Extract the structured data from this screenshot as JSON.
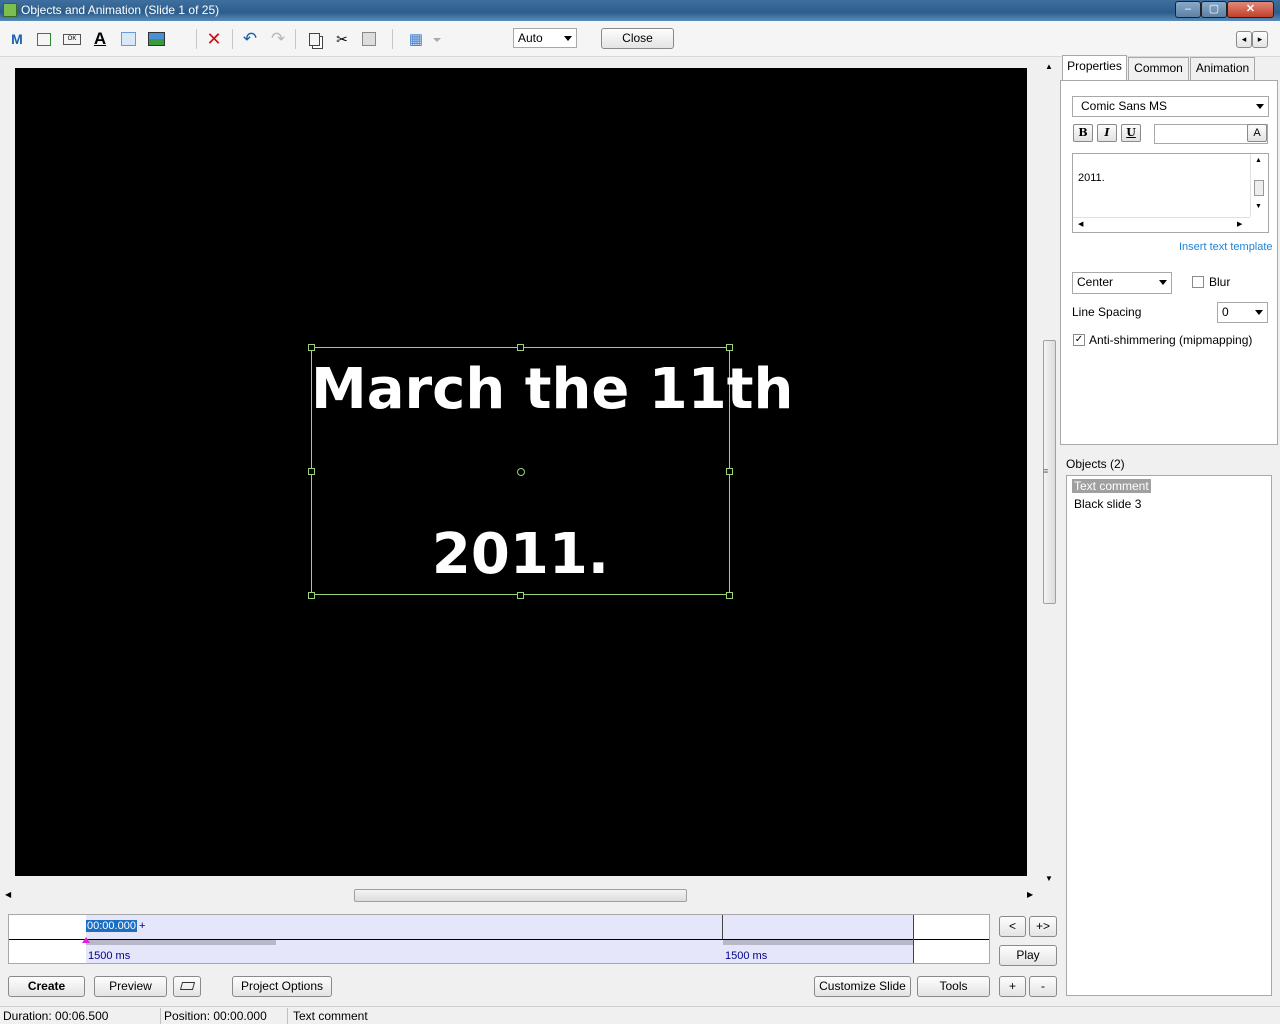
{
  "window": {
    "title": "Objects and Animation  (Slide 1 of 25)"
  },
  "toolbar": {
    "zoom_value": "Auto",
    "close_label": "Close",
    "icons": [
      "m-icon",
      "rectangle-icon",
      "button-icon",
      "text-icon",
      "frame-icon",
      "image-icon",
      "delete-icon",
      "undo-icon",
      "redo-icon",
      "copy-icon",
      "cut-icon",
      "paste-icon",
      "grid-icon"
    ]
  },
  "slide": {
    "line1": "March the 11th",
    "line2": "2011."
  },
  "tabs": {
    "properties": "Properties",
    "common": "Common",
    "animation": "Animation"
  },
  "properties": {
    "font": "Comic Sans MS",
    "bold": "B",
    "italic": "I",
    "underline": "U",
    "color_button": "A",
    "text_value": "2011.",
    "insert_template": "Insert text template",
    "align": "Center",
    "blur_label": "Blur",
    "blur_checked": false,
    "line_spacing_label": "Line Spacing",
    "line_spacing_value": "0",
    "antishimmer_label": "Anti-shimmering (mipmapping)",
    "antishimmer_checked": true
  },
  "objects": {
    "header": "Objects (2)",
    "items": [
      "Text comment",
      "Black slide 3"
    ]
  },
  "timeline": {
    "cursor_time": "00:00.000",
    "plus": "+",
    "label_a": "1500 ms",
    "label_b": "1500 ms"
  },
  "nav": {
    "prev": "<",
    "next": "+>",
    "play": "Play",
    "add": "+",
    "remove": "-"
  },
  "bottom": {
    "create": "Create",
    "preview": "Preview",
    "project_options": "Project Options",
    "customize_slide": "Customize Slide",
    "tools": "Tools"
  },
  "status": {
    "duration": "Duration:  00:06.500",
    "position": "Position:  00:00.000",
    "object": "Text comment"
  },
  "colors": {
    "selection": "#9ad27a",
    "link": "#1f84d8",
    "timeline_text": "#00008b"
  }
}
